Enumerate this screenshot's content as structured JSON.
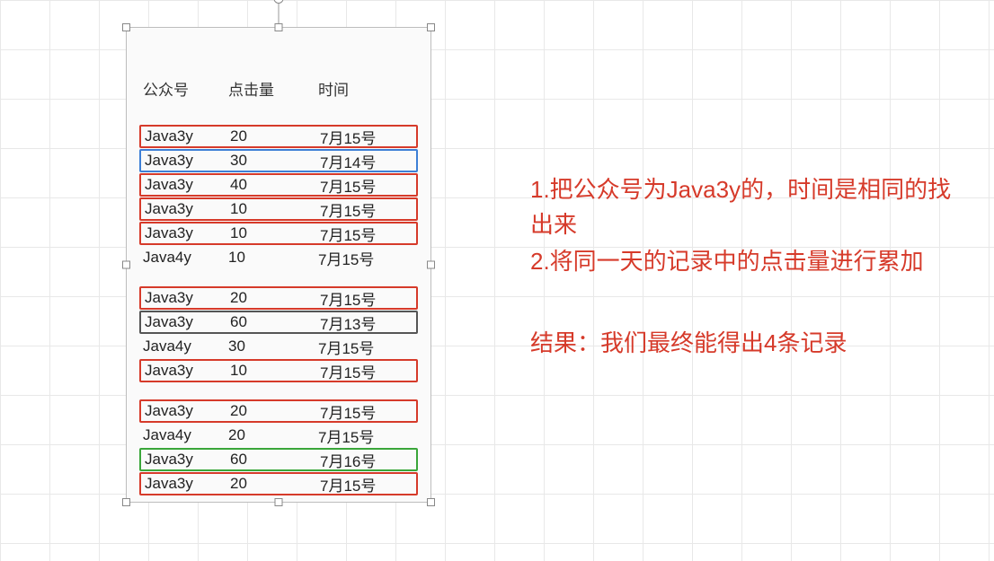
{
  "headers": {
    "col1": "公众号",
    "col2": "点击量",
    "col3": "时间"
  },
  "groups": [
    [
      {
        "account": "Java3y",
        "clicks": "20",
        "time": "7月15号",
        "box": "red"
      },
      {
        "account": "Java3y",
        "clicks": "30",
        "time": "7月14号",
        "box": "blue"
      },
      {
        "account": "Java3y",
        "clicks": "40",
        "time": "7月15号",
        "box": "red"
      },
      {
        "account": "Java3y",
        "clicks": "10",
        "time": "7月15号",
        "box": "red"
      },
      {
        "account": "Java3y",
        "clicks": "10",
        "time": "7月15号",
        "box": "red"
      },
      {
        "account": "Java4y",
        "clicks": "10",
        "time": "7月15号",
        "box": ""
      }
    ],
    [
      {
        "account": "Java3y",
        "clicks": "20",
        "time": "7月15号",
        "box": "red"
      },
      {
        "account": "Java3y",
        "clicks": "60",
        "time": "7月13号",
        "box": "gray"
      },
      {
        "account": "Java4y",
        "clicks": "30",
        "time": "7月15号",
        "box": ""
      },
      {
        "account": "Java3y",
        "clicks": "10",
        "time": "7月15号",
        "box": "red"
      }
    ],
    [
      {
        "account": "Java3y",
        "clicks": "20",
        "time": "7月15号",
        "box": "red"
      },
      {
        "account": "Java4y",
        "clicks": "20",
        "time": "7月15号",
        "box": ""
      },
      {
        "account": "Java3y",
        "clicks": "60",
        "time": "7月16号",
        "box": "green"
      },
      {
        "account": "Java3y",
        "clicks": "20",
        "time": "7月15号",
        "box": "red"
      }
    ]
  ],
  "annotation": {
    "line1": "1.把公众号为Java3y的，时间是相同的找出来",
    "line2": "2.将同一天的记录中的点击量进行累加",
    "result": "结果：我们最终能得出4条记录"
  }
}
